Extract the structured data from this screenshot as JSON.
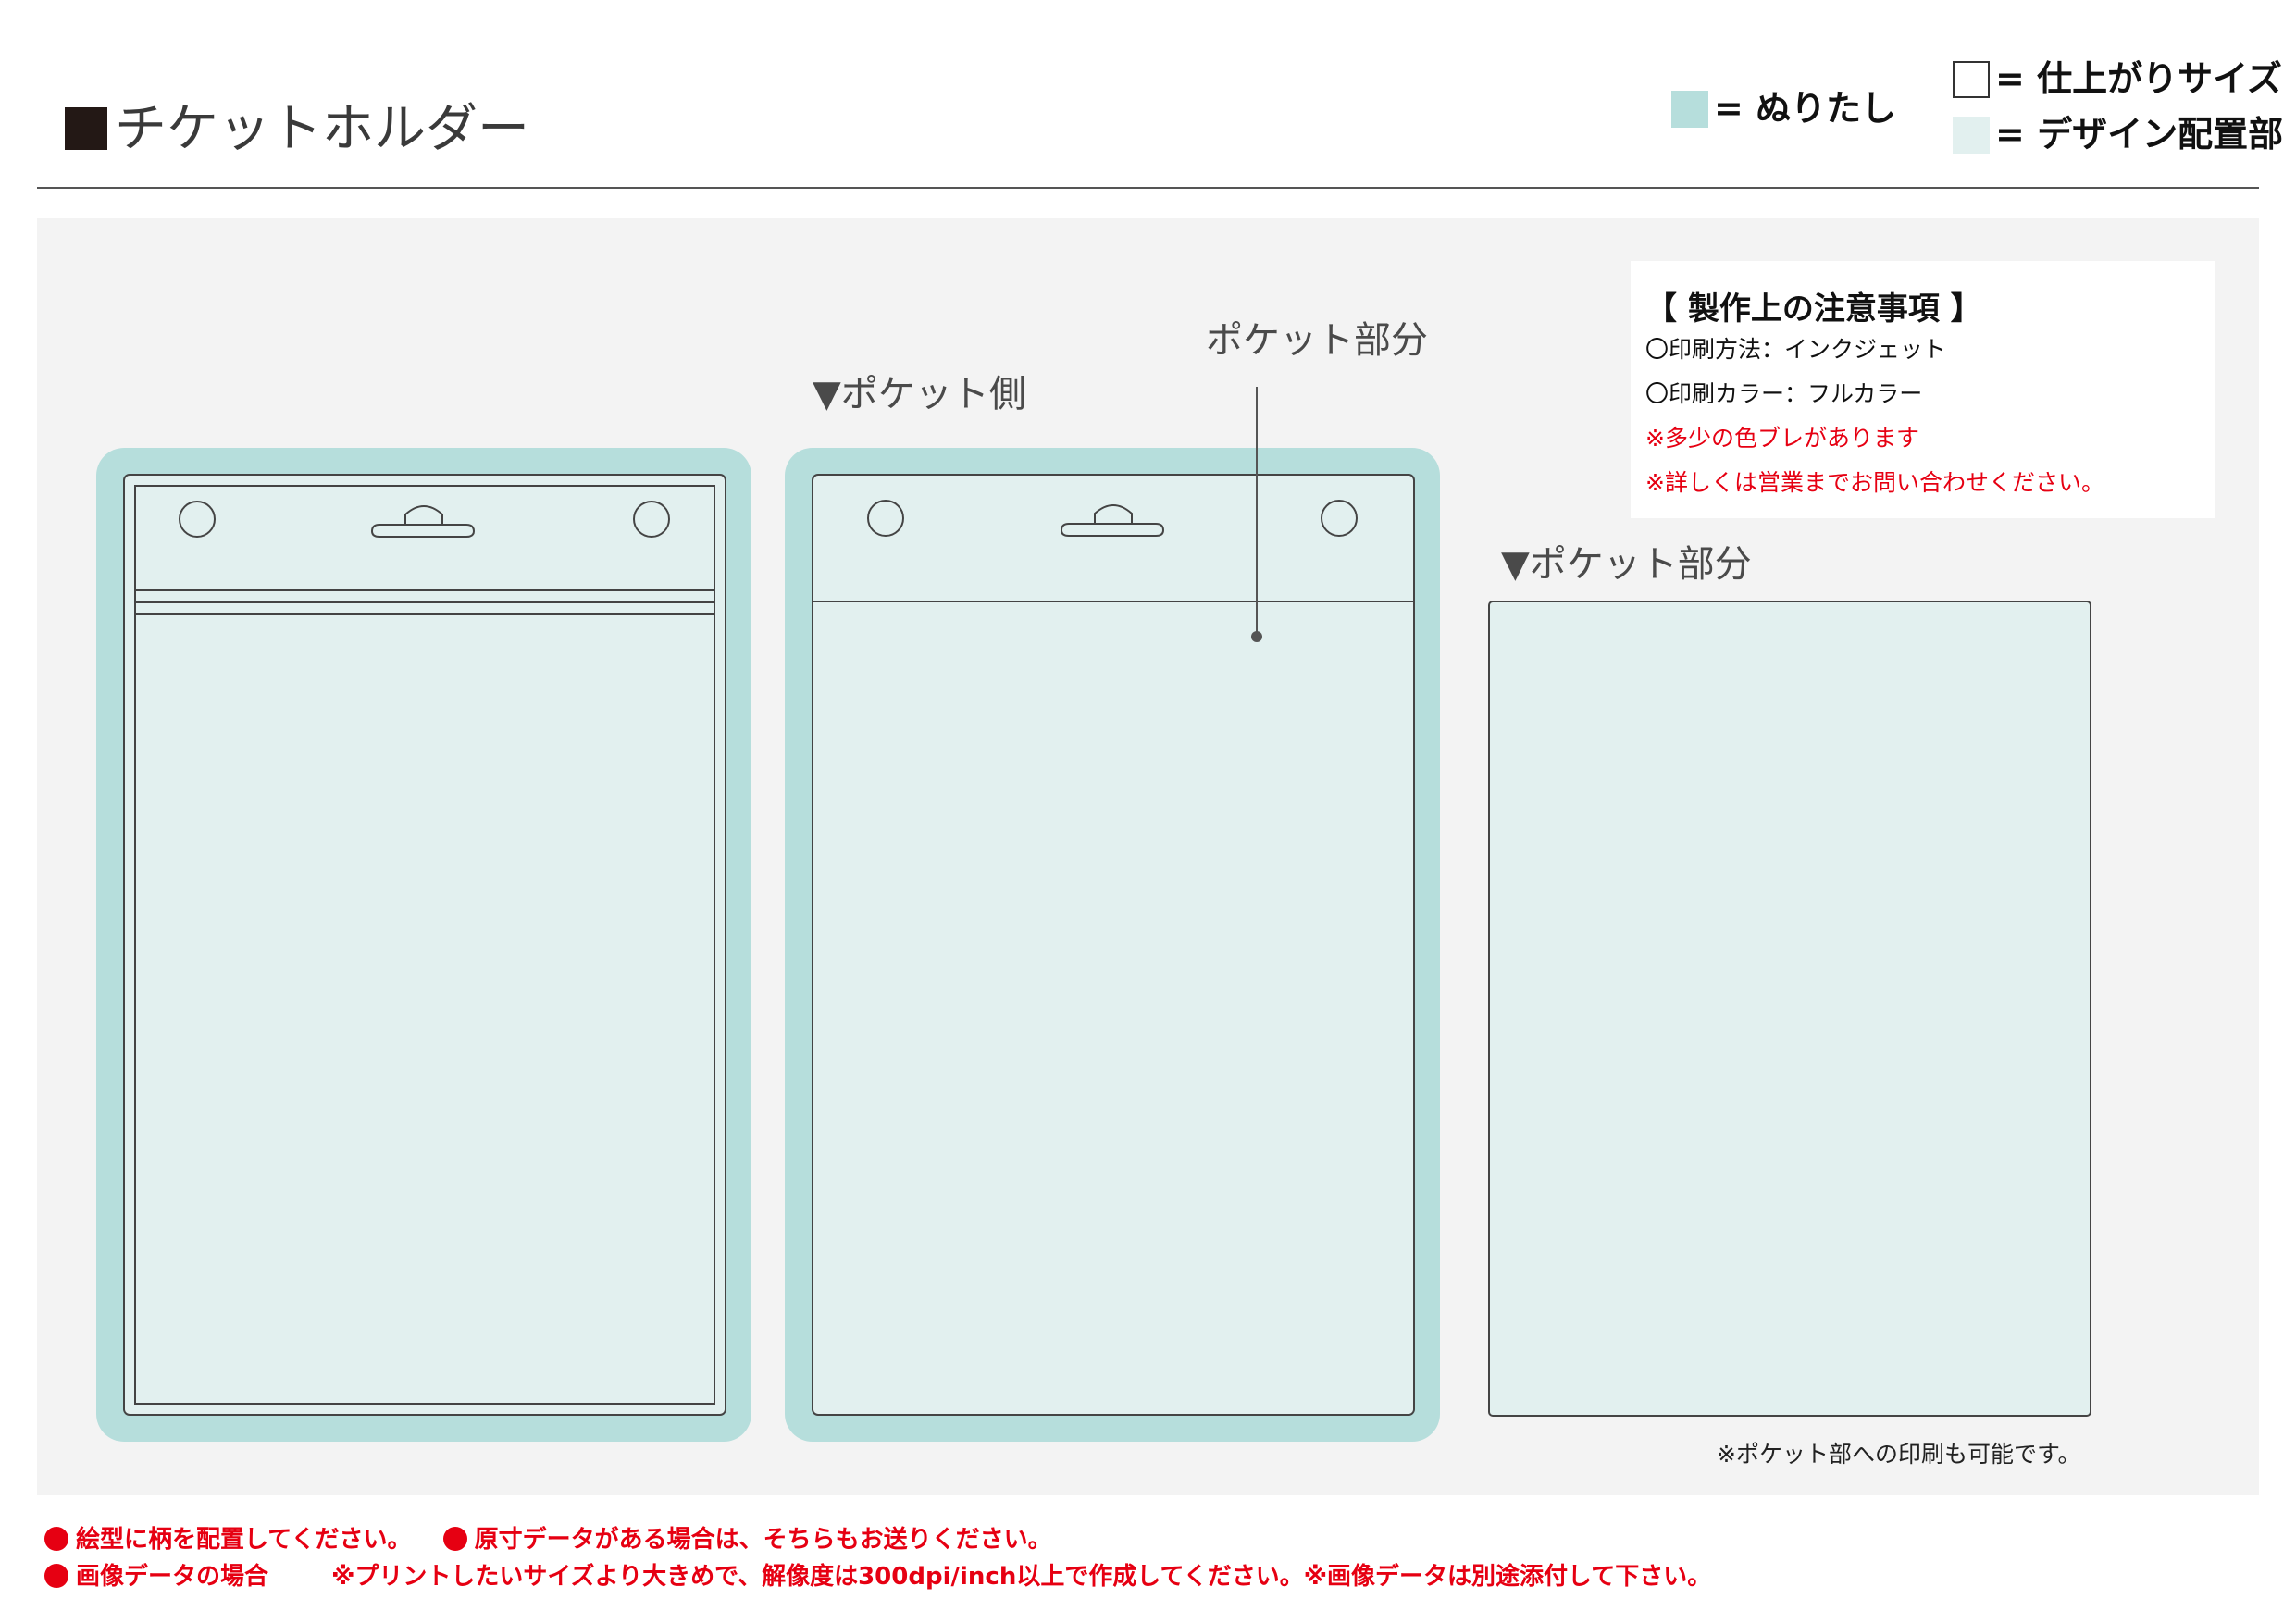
{
  "header": {
    "title": "チケットホルダー",
    "legend": {
      "bleed": "= ぬりたし",
      "finished": "= 仕上がりサイズ",
      "design": "= デザイン配置部"
    },
    "colors": {
      "bleed": "#b6dedc",
      "design": "#e2f0ef",
      "finished": "#ffffff"
    }
  },
  "labels": {
    "pocket_side": "▼ポケット側",
    "pocket_callout": "ポケット部分",
    "pocket_part": "▼ポケット部分",
    "pocket_print_note": "※ポケット部への印刷も可能です。"
  },
  "notes": {
    "heading": "【 製作上の注意事項 】",
    "lines": [
      "〇印刷方法：インクジェット",
      "〇印刷カラー：フルカラー",
      "※多少の色ブレがあります",
      "※詳しくは営業までお問い合わせください。"
    ]
  },
  "footer": {
    "line1_a": "絵型に柄を配置してください。",
    "line1_b": "原寸データがある場合は、そちらもお送りください。",
    "line2_a": "画像データの場合",
    "line2_b": "※プリントしたいサイズより大きめで、解像度は300dpi/inch以上で作成してください。※画像データは別途添付して下さい。"
  }
}
